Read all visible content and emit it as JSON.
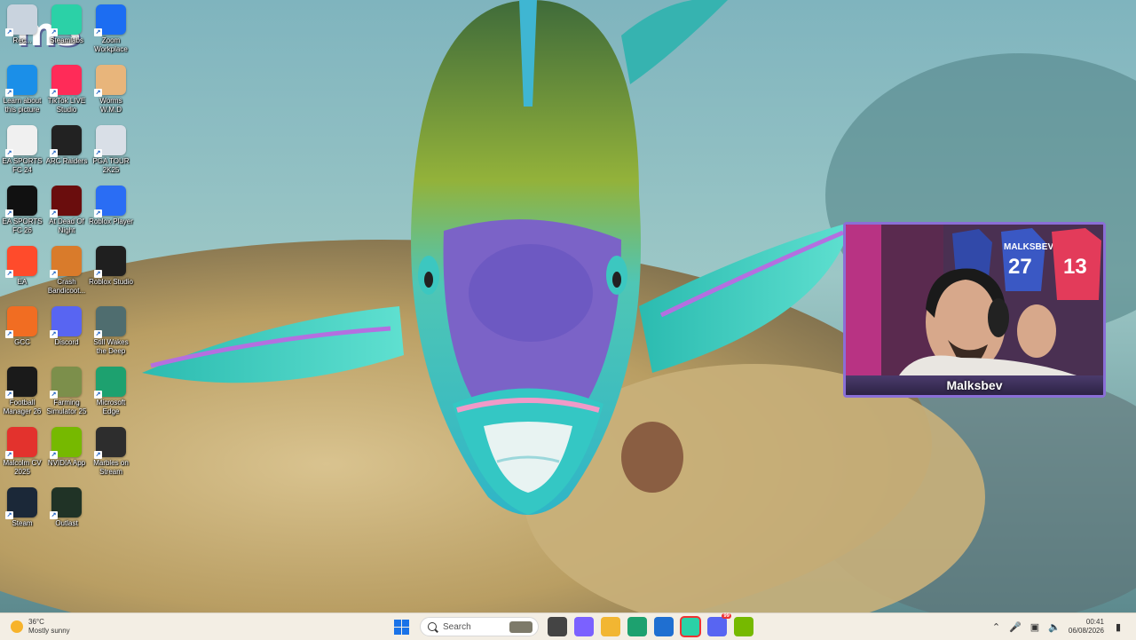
{
  "logo_text": "m3",
  "desktop_icons": [
    {
      "label": "Rec...",
      "icon": "recycle-bin-icon",
      "color": "#c9d3de"
    },
    {
      "label": "Steamlabs",
      "icon": "streamlabs-icon",
      "color": "#2bd1a7"
    },
    {
      "label": "Zoom Workplace",
      "icon": "zoom-icon",
      "color": "#1c6df2"
    },
    {
      "label": "Learn about this picture",
      "icon": "learn-picture-icon",
      "color": "#1b8fe8"
    },
    {
      "label": "TikTok LIVE Studio",
      "icon": "tiktok-icon",
      "color": "#ff2b58"
    },
    {
      "label": "Worms W.M.D",
      "icon": "worms-icon",
      "color": "#e8b57b"
    },
    {
      "label": "EA SPORTS FC 24",
      "icon": "fc24-icon",
      "color": "#f0f0f0"
    },
    {
      "label": "ARC Raiders",
      "icon": "arc-raiders-icon",
      "color": "#222222"
    },
    {
      "label": "PGA TOUR 2K25",
      "icon": "pga-tour-icon",
      "color": "#d9dfe7"
    },
    {
      "label": "EA SPORTS FC 26",
      "icon": "fc26-icon",
      "color": "#111111"
    },
    {
      "label": "At Dead Of Night",
      "icon": "dead-of-night-icon",
      "color": "#6a0d0d"
    },
    {
      "label": "Roblox Player",
      "icon": "roblox-player-icon",
      "color": "#2a6df4"
    },
    {
      "label": "EA",
      "icon": "ea-icon",
      "color": "#ff4b2b"
    },
    {
      "label": "Crash Bandicoot...",
      "icon": "crash-bandicoot-icon",
      "color": "#d97b2b"
    },
    {
      "label": "Roblox Studio",
      "icon": "roblox-studio-icon",
      "color": "#1f1f1f"
    },
    {
      "label": "GCC",
      "icon": "gcc-icon",
      "color": "#f16d22"
    },
    {
      "label": "Discord",
      "icon": "discord-icon",
      "color": "#5865f2"
    },
    {
      "label": "Still Wakes the Deep",
      "icon": "still-wakes-icon",
      "color": "#4f6d6f"
    },
    {
      "label": "Football Manager 26",
      "icon": "football-manager-icon",
      "color": "#1a1a1a"
    },
    {
      "label": "Farming Simulator 25",
      "icon": "farming-sim-icon",
      "color": "#7c8f4b"
    },
    {
      "label": "Microsoft Edge",
      "icon": "edge-icon",
      "color": "#1da16f"
    },
    {
      "label": "Malcolm CV 2025",
      "icon": "pdf-file-icon",
      "color": "#e3322d"
    },
    {
      "label": "NVIDIA App",
      "icon": "nvidia-icon",
      "color": "#76b900"
    },
    {
      "label": "Marbles on Stream",
      "icon": "marbles-icon",
      "color": "#2d2d2d"
    },
    {
      "label": "Steam",
      "icon": "steam-icon",
      "color": "#1b2838"
    },
    {
      "label": "Outlast",
      "icon": "outlast-icon",
      "color": "#203326"
    }
  ],
  "webcam": {
    "username": "Malksbev",
    "jersey_text": "MALKSBEV",
    "jersey_numbers": [
      "27",
      "13"
    ],
    "frame_color": "#8a6fd6"
  },
  "taskbar": {
    "weather_temp": "36°C",
    "weather_desc": "Mostly sunny",
    "search_placeholder": "Search",
    "time": "00:41",
    "date": "06/08/2026",
    "center_icons": [
      {
        "name": "windows-start-icon",
        "color": "#1a73e8"
      },
      {
        "name": "task-view-icon",
        "color": "#444444"
      },
      {
        "name": "copilot-icon",
        "color": "#7b61ff"
      },
      {
        "name": "file-explorer-icon",
        "color": "#f2b632"
      },
      {
        "name": "edge-taskbar-icon",
        "color": "#1da16f"
      },
      {
        "name": "app-installer-icon",
        "color": "#1f6fd1"
      },
      {
        "name": "streamlabs-taskbar-icon",
        "color": "#2bd1a7"
      },
      {
        "name": "discord-taskbar-icon",
        "color": "#5865f2"
      },
      {
        "name": "nvidia-taskbar-icon",
        "color": "#76b900"
      }
    ],
    "discord_badge": "99",
    "tray_icons": [
      "chevron-up-icon",
      "microphone-icon",
      "network-icon",
      "volume-icon",
      "notification-icon"
    ]
  }
}
